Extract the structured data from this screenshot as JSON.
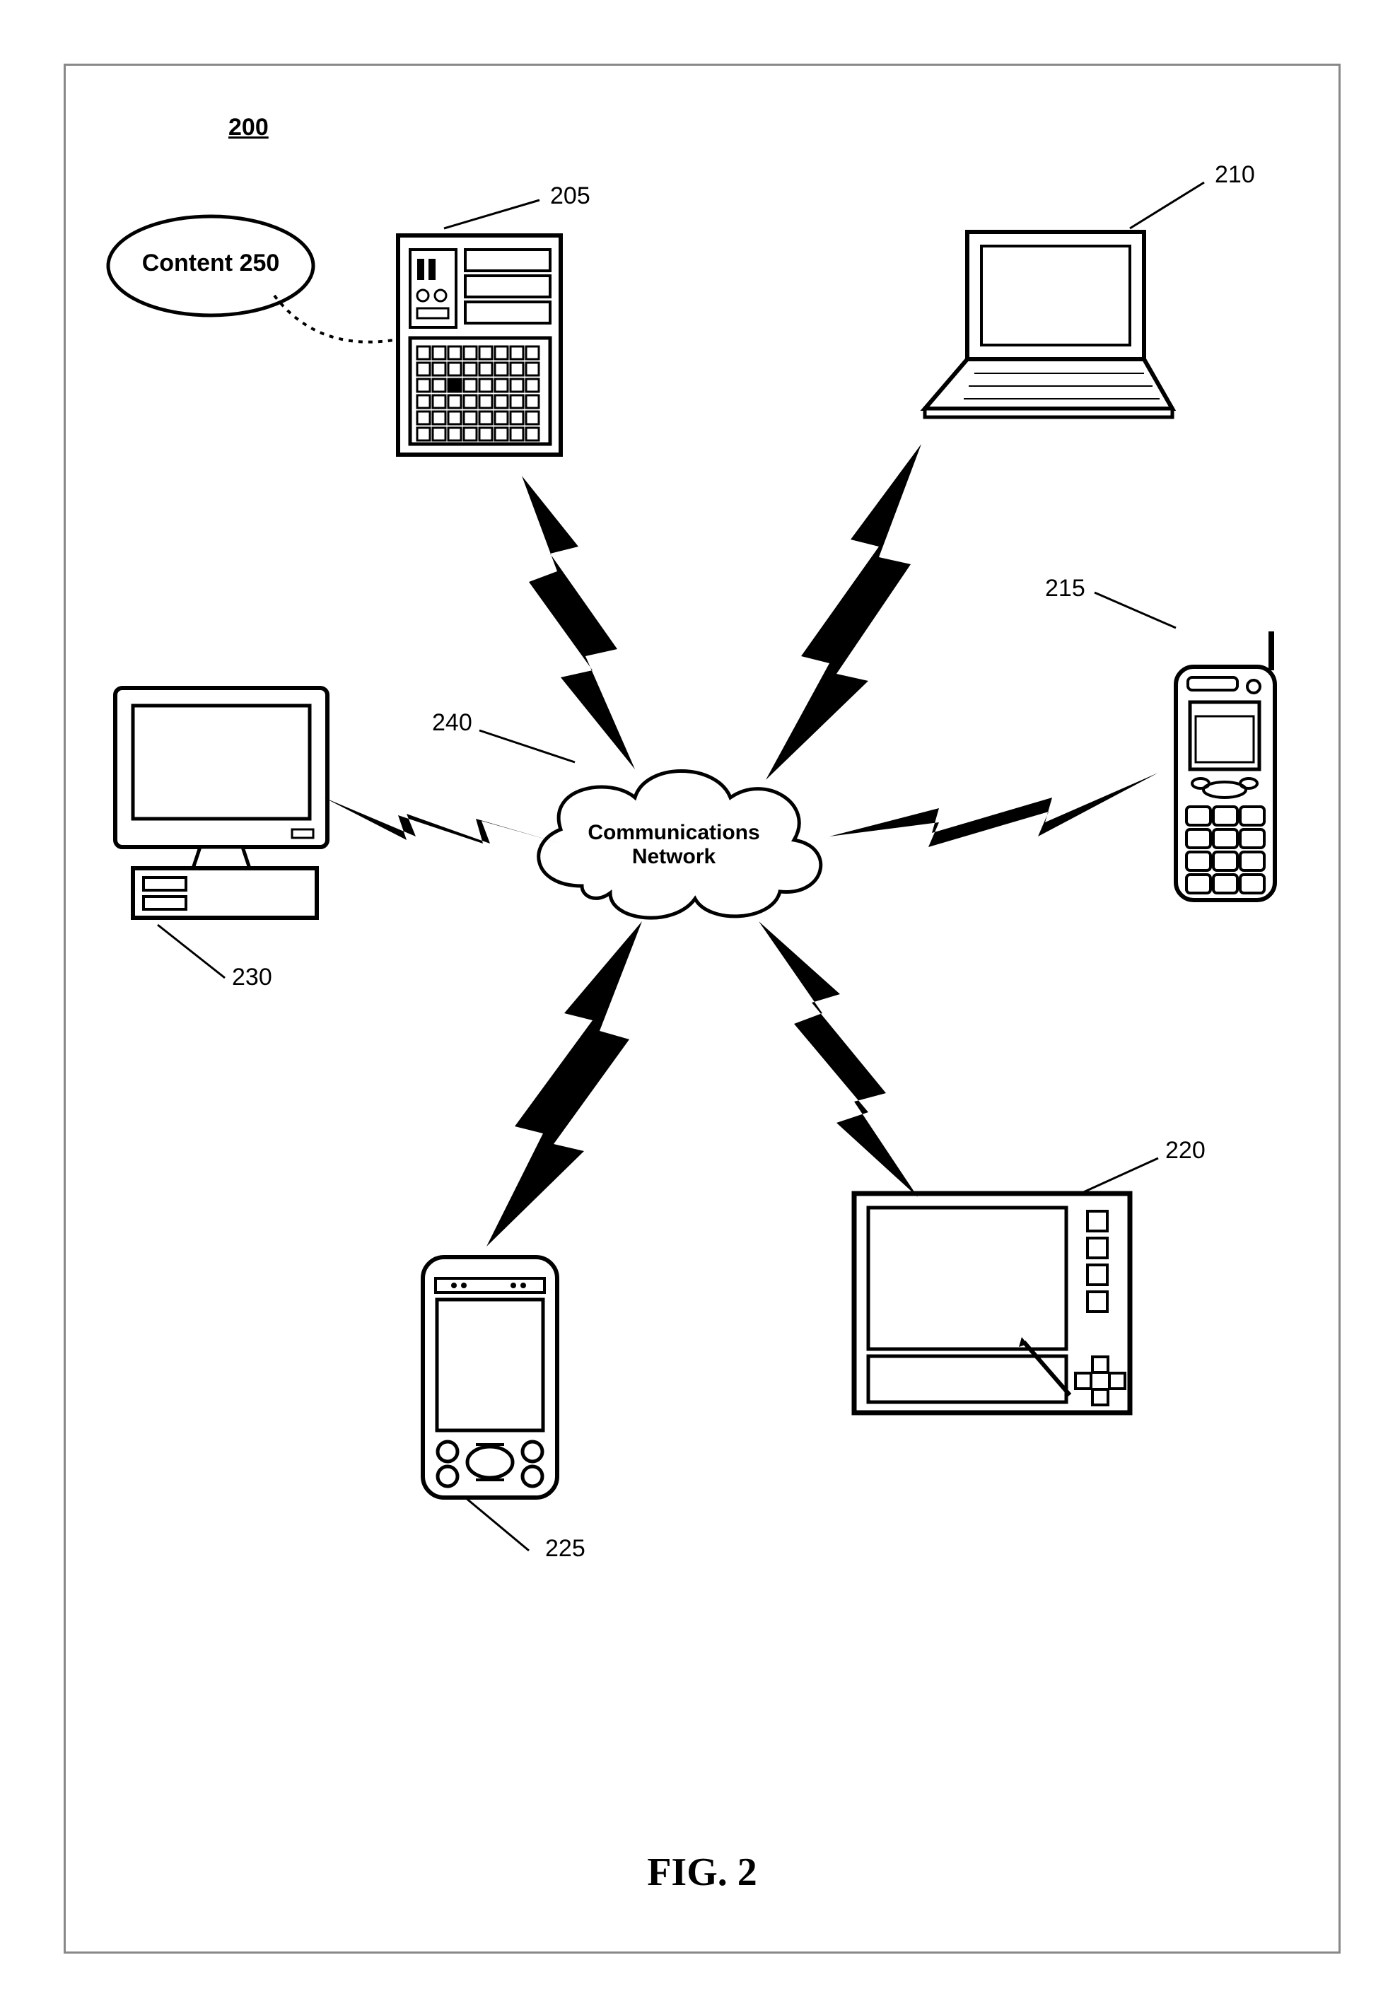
{
  "figure_caption": "FIG. 2",
  "system_ref": "200",
  "nodes": {
    "content": {
      "ref": "250",
      "label": "Content"
    },
    "server": {
      "ref": "205"
    },
    "laptop": {
      "ref": "210"
    },
    "phone": {
      "ref": "215"
    },
    "tablet": {
      "ref": "220"
    },
    "pda": {
      "ref": "225"
    },
    "desktop": {
      "ref": "230"
    },
    "cloud": {
      "ref": "240",
      "label_line1": "Communications",
      "label_line2": "Network"
    }
  }
}
